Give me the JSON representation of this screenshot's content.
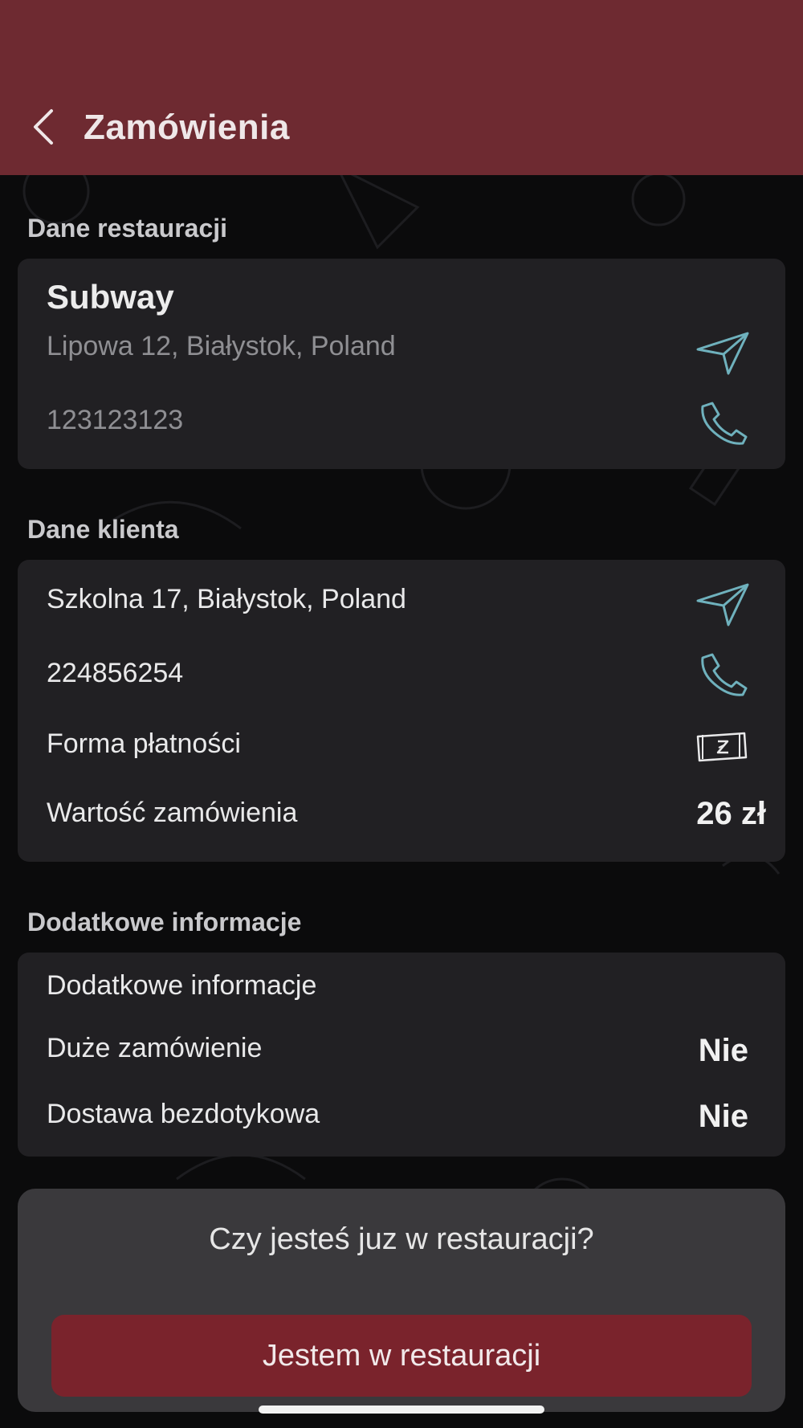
{
  "header": {
    "title": "Zamówienia"
  },
  "restaurant_section": {
    "label": "Dane restauracji",
    "name": "Subway",
    "address": "Lipowa 12, Białystok, Poland",
    "phone": "123123123"
  },
  "client_section": {
    "label": "Dane klienta",
    "address": "Szkolna 17, Białystok, Poland",
    "phone": "224856254",
    "payment_label": "Forma płatności",
    "order_value_label": "Wartość zamówienia",
    "order_value": "26 zł"
  },
  "extra_section": {
    "label": "Dodatkowe informacje",
    "title": "Dodatkowe informacje",
    "rows": [
      {
        "label": "Duże zamówienie",
        "value": "Nie"
      },
      {
        "label": "Dostawa bezdotykowa",
        "value": "Nie"
      }
    ]
  },
  "arrival": {
    "question": "Czy jesteś juz w restauracji?",
    "button_label": "Jestem w restauracji"
  },
  "icons": {
    "back": "chevron-left-icon",
    "navigate": "navigation-arrow-icon",
    "phone": "phone-icon",
    "cash": "cash-zloty-icon"
  },
  "colors": {
    "header_bg": "#6e2a31",
    "accent_icon": "#6fb1bd",
    "card_bg": "#212023",
    "button_bg": "#7a232c",
    "panel_bg": "#3a393c"
  }
}
